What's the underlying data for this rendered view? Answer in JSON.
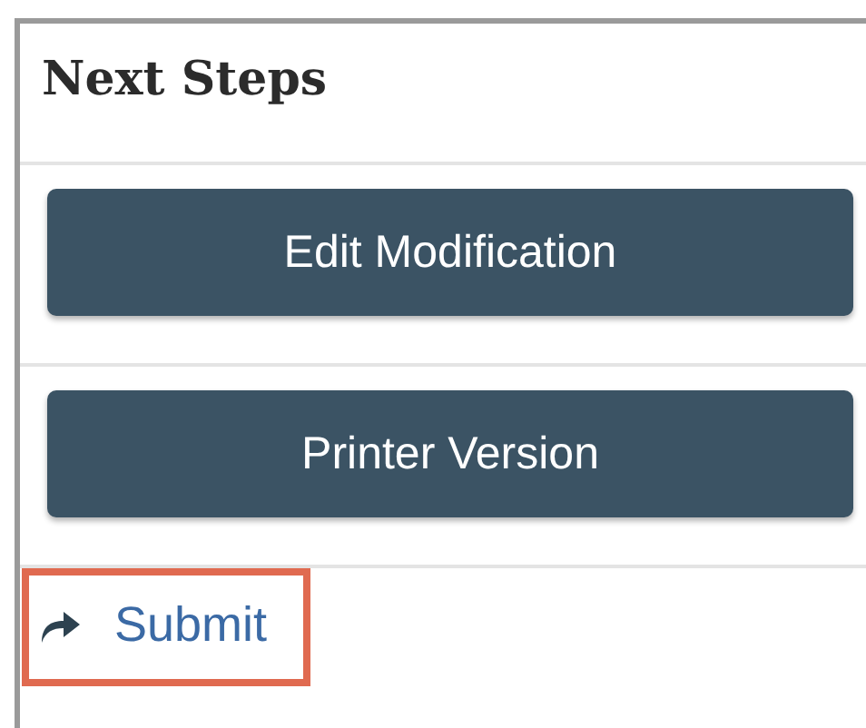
{
  "panel": {
    "title": "Next Steps",
    "actions": [
      {
        "kind": "button",
        "label": "Edit Modification"
      },
      {
        "kind": "button",
        "label": "Printer Version"
      },
      {
        "kind": "link",
        "label": "Submit",
        "highlighted": true
      }
    ]
  }
}
